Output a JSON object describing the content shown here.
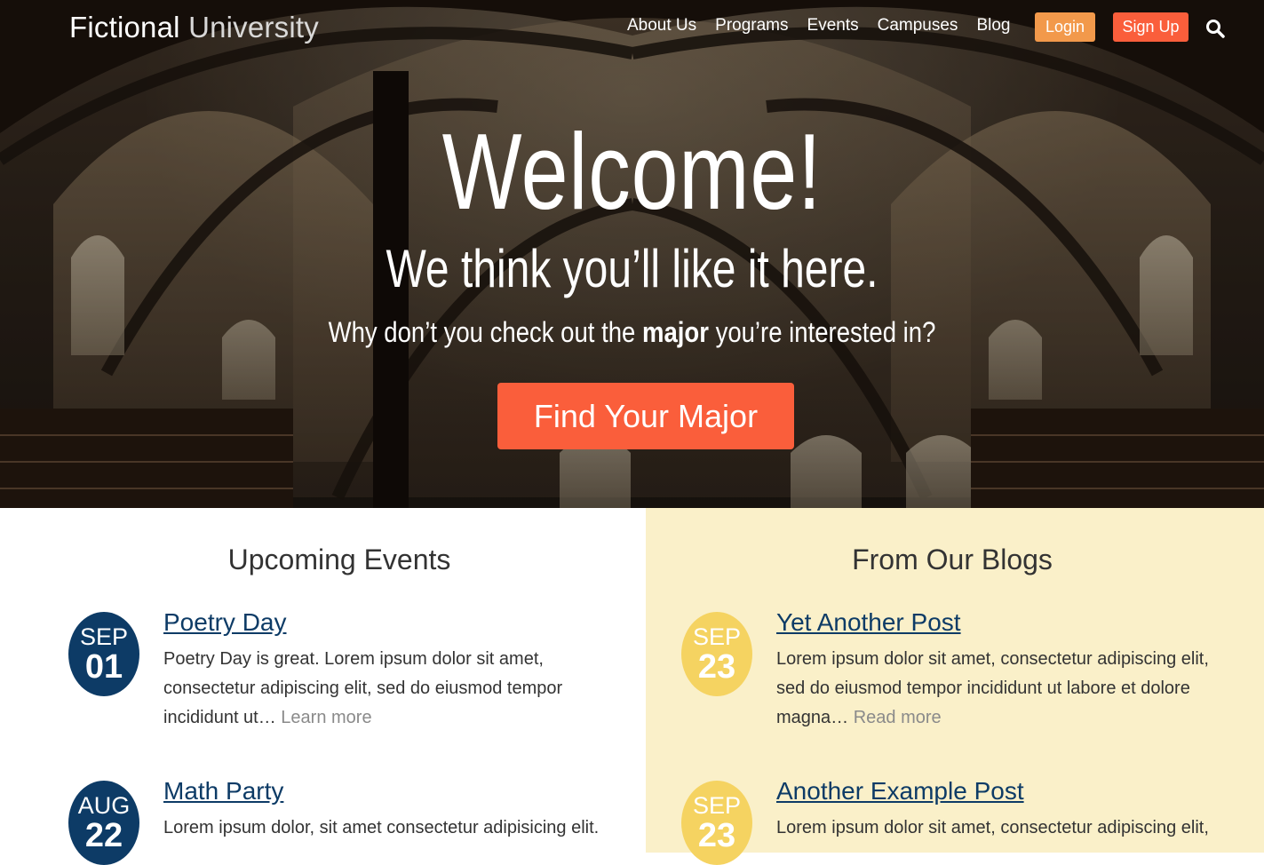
{
  "header": {
    "logo_bold": "Fictional",
    "logo_light": "University",
    "nav": [
      "About Us",
      "Programs",
      "Events",
      "Campuses",
      "Blog"
    ],
    "login_label": "Login",
    "signup_label": "Sign Up",
    "search_icon": "search-icon"
  },
  "hero": {
    "title": "Welcome!",
    "subtitle": "We think you’ll like it here.",
    "lead_before": "Why don’t you check out the ",
    "lead_bold": "major",
    "lead_after": " you’re interested in?",
    "button_label": "Find Your Major"
  },
  "events": {
    "heading": "Upcoming Events",
    "items": [
      {
        "month": "SEP",
        "day": "01",
        "title": "Poetry Day",
        "text": "Poetry Day is great. Lorem ipsum dolor sit amet, consectetur adipiscing elit, sed do eiusmod tempor incididunt ut… ",
        "link": "Learn more"
      },
      {
        "month": "AUG",
        "day": "22",
        "title": "Math Party",
        "text": "Lorem ipsum dolor, sit amet consectetur adipisicing elit."
      }
    ]
  },
  "blogs": {
    "heading": "From Our Blogs",
    "items": [
      {
        "month": "SEP",
        "day": "23",
        "title": "Yet Another Post",
        "text": "Lorem ipsum dolor sit amet, consectetur adipiscing elit, sed do eiusmod tempor incididunt ut labore et dolore magna… ",
        "link": "Read more"
      },
      {
        "month": "SEP",
        "day": "23",
        "title": "Another Example Post",
        "text": "Lorem ipsum dolor sit amet, consectetur adipiscing elit,"
      }
    ]
  },
  "colors": {
    "accent_orange": "#fa5e3b",
    "login_orange": "#f2994b",
    "navy": "#0d3b66",
    "yellow": "#f5d361",
    "blog_bg": "#faf0c9"
  }
}
